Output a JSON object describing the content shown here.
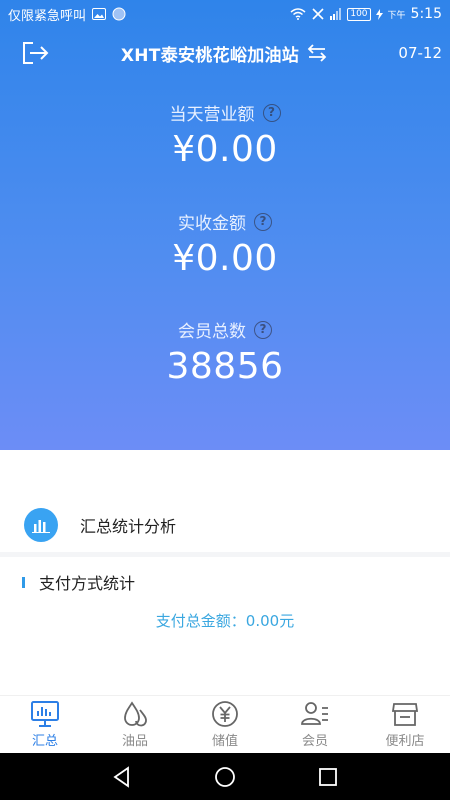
{
  "status_bar": {
    "carrier_text": "仅限紧急呼叫",
    "battery": "100",
    "ampm": "下午",
    "time": "5:15"
  },
  "header": {
    "station_name": "XHT泰安桃花峪加油站",
    "date": "07-12"
  },
  "metrics": [
    {
      "label": "当天营业额",
      "value": "¥0.00"
    },
    {
      "label": "实收金额",
      "value": "¥0.00"
    },
    {
      "label": "会员总数",
      "value": "38856"
    }
  ],
  "help_mark": "?",
  "analysis": {
    "label": "汇总统计分析"
  },
  "payment": {
    "title": "支付方式统计",
    "total": "支付总金额：0.00元"
  },
  "tabs": [
    {
      "label": "汇总",
      "icon": "summary-monitor-icon",
      "active": true
    },
    {
      "label": "油品",
      "icon": "oil-drops-icon",
      "active": false
    },
    {
      "label": "储值",
      "icon": "yuan-coin-icon",
      "active": false
    },
    {
      "label": "会员",
      "icon": "member-card-icon",
      "active": false
    },
    {
      "label": "便利店",
      "icon": "store-icon",
      "active": false
    }
  ],
  "colors": {
    "accent": "#2c7fe6",
    "hero_top": "#2f84ea",
    "hero_bottom": "#6c8df6",
    "inactive_tab": "#8a8a8a",
    "pay_total": "#3aa7e0"
  }
}
